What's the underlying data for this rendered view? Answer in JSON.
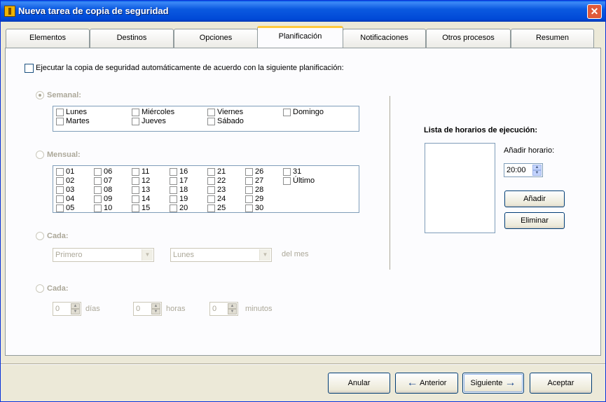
{
  "window": {
    "title": "Nueva tarea de copia de seguridad",
    "close": "✕"
  },
  "tabs": [
    "Elementos",
    "Destinos",
    "Opciones",
    "Planificación",
    "Notificaciones",
    "Otros procesos",
    "Resumen"
  ],
  "active_tab": "Planificación",
  "schedule": {
    "enable_label": "Ejecutar la copia de seguridad automáticamente de acuerdo con la siguiente planificación:",
    "weekly": {
      "label": "Semanal:",
      "days": [
        "Lunes",
        "Martes",
        "Miércoles",
        "Jueves",
        "Viernes",
        "Sábado",
        "Domingo"
      ]
    },
    "monthly": {
      "label": "Mensual:",
      "days": [
        "01",
        "02",
        "03",
        "04",
        "05",
        "06",
        "07",
        "08",
        "09",
        "10",
        "11",
        "12",
        "13",
        "14",
        "15",
        "16",
        "17",
        "18",
        "19",
        "20",
        "21",
        "22",
        "23",
        "24",
        "25",
        "26",
        "27",
        "28",
        "29",
        "30",
        "31",
        "Último"
      ]
    },
    "every_day": {
      "label": "Cada:",
      "ordinal": "Primero",
      "weekday": "Lunes",
      "suffix": "del mes"
    },
    "every_interval": {
      "label": "Cada:",
      "days_value": "0",
      "days_unit": "días",
      "hours_value": "0",
      "hours_unit": "horas",
      "minutes_value": "0",
      "minutes_unit": "minutos"
    }
  },
  "run_list": {
    "title": "Lista de horarios de ejecución:",
    "add_time_label": "Añadir horario:",
    "time_value": "20:00",
    "add_button": "Añadir",
    "remove_button": "Eliminar"
  },
  "footer": {
    "cancel": "Anular",
    "back": "Anterior",
    "next": "Siguiente",
    "ok": "Aceptar"
  }
}
